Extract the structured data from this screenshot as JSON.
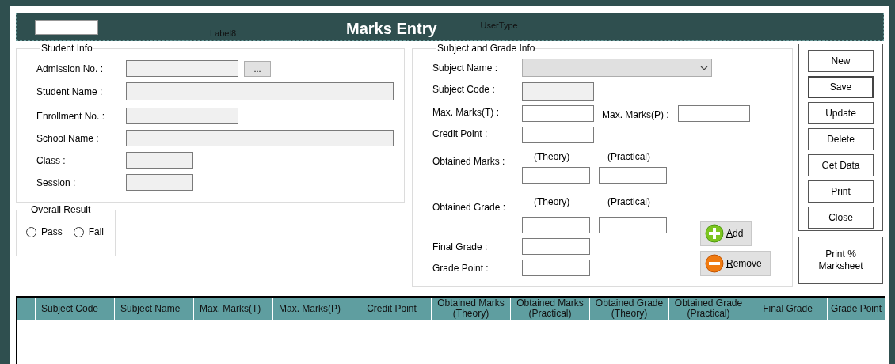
{
  "header": {
    "title": "Marks Entry",
    "label": "Label8",
    "user_type": "UserType"
  },
  "student_info": {
    "title": "Student Info",
    "fields": [
      {
        "label": "Admission No. :",
        "disabled": true,
        "browse": "..."
      },
      {
        "label": "Student Name :",
        "disabled": true
      },
      {
        "label": "Enrollment No. :",
        "disabled": true
      },
      {
        "label": "School Name :",
        "disabled": true
      },
      {
        "label": "Class :",
        "disabled": true
      },
      {
        "label": "Session :",
        "disabled": true
      }
    ]
  },
  "overall_result": {
    "title": "Overall Result",
    "options": [
      {
        "label": "Pass",
        "selected": false
      },
      {
        "label": "Fail",
        "selected": false
      }
    ]
  },
  "subject_info": {
    "title": "Subject and Grade Info",
    "subject_name": {
      "label": "Subject Name :",
      "disabled": true
    },
    "subject_code": {
      "label": "Subject Code :",
      "disabled": true
    },
    "max_marks_t": {
      "label": "Max. Marks(T) :",
      "disabled": false
    },
    "max_marks_p": {
      "label": "Max. Marks(P) :",
      "disabled": false
    },
    "credit_point": {
      "label": "Credit Point :",
      "disabled": false
    },
    "obtained_marks": {
      "label": "Obtained Marks :",
      "theory": "(Theory)",
      "practical": "(Practical)"
    },
    "obtained_grade": {
      "label": "Obtained Grade :",
      "theory": "(Theory)",
      "practical": "(Practical)"
    },
    "final_grade": {
      "label": "Final Grade :",
      "disabled": false
    },
    "grade_point": {
      "label": "Grade Point :",
      "disabled": false
    },
    "add_button": {
      "label": "Add"
    },
    "remove_button": {
      "label": "Remove"
    }
  },
  "actions": [
    {
      "label": "New",
      "default": false
    },
    {
      "label": "Save",
      "default": true
    },
    {
      "label": "Update",
      "default": false
    },
    {
      "label": "Delete",
      "default": false
    },
    {
      "label": "Get Data",
      "default": false
    },
    {
      "label": "Print",
      "default": false
    },
    {
      "label": "Close",
      "default": false
    }
  ],
  "print_marksheet": {
    "label": "Print % Marksheet"
  },
  "grid": {
    "columns": [
      "Subject Code",
      "Subject Name",
      "Max. Marks(T)",
      "Max. Marks(P)",
      "Credit Point",
      "Obtained Marks (Theory)",
      "Obtained Marks (Practical)",
      "Obtained Grade (Theory)",
      "Obtained Grade (Practical)",
      "Final Grade",
      "Grade Point"
    ]
  }
}
